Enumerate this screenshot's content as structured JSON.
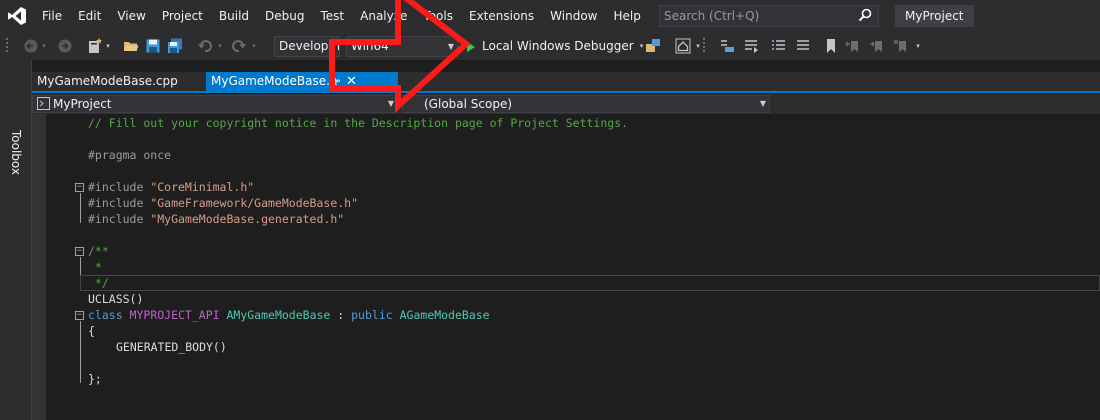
{
  "menubar": {
    "items": [
      "File",
      "Edit",
      "View",
      "Project",
      "Build",
      "Debug",
      "Test",
      "Analyze",
      "Tools",
      "Extensions",
      "Window",
      "Help"
    ],
    "search_placeholder": "Search (Ctrl+Q)",
    "project_name": "MyProject"
  },
  "toolbar": {
    "configuration": "Developm",
    "platform": "Win64",
    "debugger": "Local Windows Debugger"
  },
  "sidebar": {
    "toolbox_label": "Toolbox"
  },
  "tabs": [
    {
      "label": "MyGameModeBase.cpp",
      "active": false
    },
    {
      "label": "MyGameModeBase.h",
      "active": true
    }
  ],
  "navbar": {
    "project": "MyProject",
    "scope": "(Global Scope)"
  },
  "code": {
    "copyright": "// Fill out your copyright notice in the Description page of Project Settings.",
    "pragma": "#pragma once",
    "include_kw": "#include ",
    "include_1": "\"CoreMinimal.h\"",
    "include_2": "\"GameFramework/GameModeBase.h\"",
    "include_3": "\"MyGameModeBase.generated.h\"",
    "doc_open": "/**",
    "doc_mid": " *",
    "doc_close": " */",
    "uclass": "UCLASS()",
    "class_kw": "class ",
    "api_macro": "MYPROJECT_API ",
    "class_name": "AMyGameModeBase",
    "colon": " : ",
    "public_kw": "public ",
    "base_class": "AGameModeBase",
    "brace_open": "{",
    "generated_body": "GENERATED_BODY()",
    "brace_close": "};"
  },
  "colors": {
    "accent": "#007acc",
    "annotation": "#ff1a1a"
  }
}
